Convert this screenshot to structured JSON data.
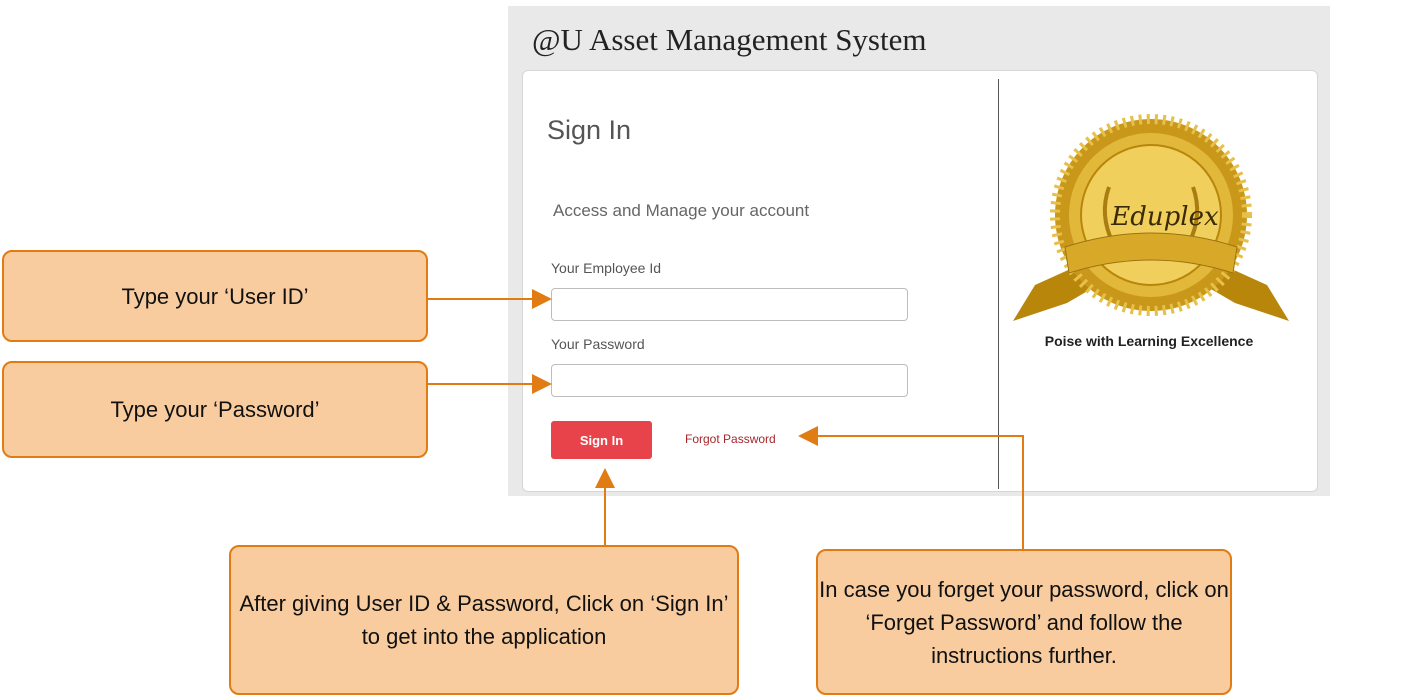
{
  "app": {
    "title": "@U Asset Management System"
  },
  "signin": {
    "heading": "Sign In",
    "subtitle": "Access and Manage your account",
    "employee_id_label": "Your Employee Id",
    "employee_id_value": "",
    "password_label": "Your Password",
    "password_value": "",
    "signin_button": "Sign In",
    "forgot_link": "Forgot Password"
  },
  "brand": {
    "seal_text": "Eduplex",
    "tagline": "Poise with Learning Excellence"
  },
  "callouts": {
    "user_id": "Type your ‘User ID’",
    "password": "Type your ‘Password’",
    "signin": "After giving User ID & Password, Click on ‘Sign In’ to get into the application",
    "forgot": "In case you forget your password, click on ‘Forget Password’ and follow the instructions further."
  },
  "colors": {
    "callout_fill": "#f8cc9e",
    "callout_border": "#e07c13",
    "signin_button": "#e8434a",
    "forgot_link": "#a5262d",
    "seal_gold": "#d4a420"
  }
}
